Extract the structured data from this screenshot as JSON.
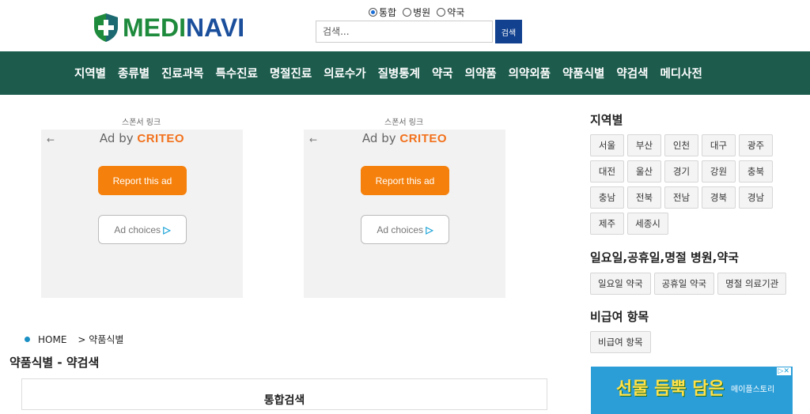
{
  "logo": {
    "part1": "MEDI",
    "part2": "NAVI"
  },
  "search": {
    "types": [
      {
        "label": "통합",
        "checked": true
      },
      {
        "label": "병원",
        "checked": false
      },
      {
        "label": "약국",
        "checked": false
      }
    ],
    "placeholder": "검색...",
    "button_label": "검색"
  },
  "nav": {
    "items": [
      "지역별",
      "종류별",
      "진료과목",
      "특수진료",
      "명절진료",
      "의료수가",
      "질병통계",
      "약국",
      "의약품",
      "의약외품",
      "약품식별",
      "약검색",
      "메디사전"
    ]
  },
  "ads": [
    {
      "sponsor": "스폰서 링크",
      "back": "←",
      "adby": "Ad by",
      "brand": "CRITEO",
      "report": "Report this ad",
      "choices": "Ad choices",
      "choices_icon": "▷"
    },
    {
      "sponsor": "스폰서 링크",
      "back": "←",
      "adby": "Ad by",
      "brand": "CRITEO",
      "report": "Report this ad",
      "choices": "Ad choices",
      "choices_icon": "▷"
    }
  ],
  "breadcrumb": {
    "home": "HOME",
    "current": "> 약품식별"
  },
  "page_title": "약품식별 - 약검색",
  "content": {
    "heading": "통합검색"
  },
  "sidebar": {
    "region_title": "지역별",
    "regions": [
      "서울",
      "부산",
      "인천",
      "대구",
      "광주",
      "대전",
      "울산",
      "경기",
      "강원",
      "충북",
      "충남",
      "전북",
      "전남",
      "경북",
      "경남",
      "제주",
      "세종시"
    ],
    "holiday_title": "일요일,공휴일,명절 병원,약국",
    "holiday_items": [
      "일요일 약국",
      "공휴일 약국",
      "명절 의료기관"
    ],
    "noncovered_title": "비급여 항목",
    "noncovered_items": [
      "비급여 항목"
    ],
    "banner": {
      "headline": "선물 듬뿍 담은",
      "brand": "메이플스토리",
      "ad_mark": "▷✕"
    }
  },
  "colors": {
    "nav_bg": "#1d5c4d",
    "search_btn": "#12418f",
    "report_btn": "#f5800b",
    "logo_green": "#1e8a3c",
    "logo_blue": "#1b4f9c"
  }
}
